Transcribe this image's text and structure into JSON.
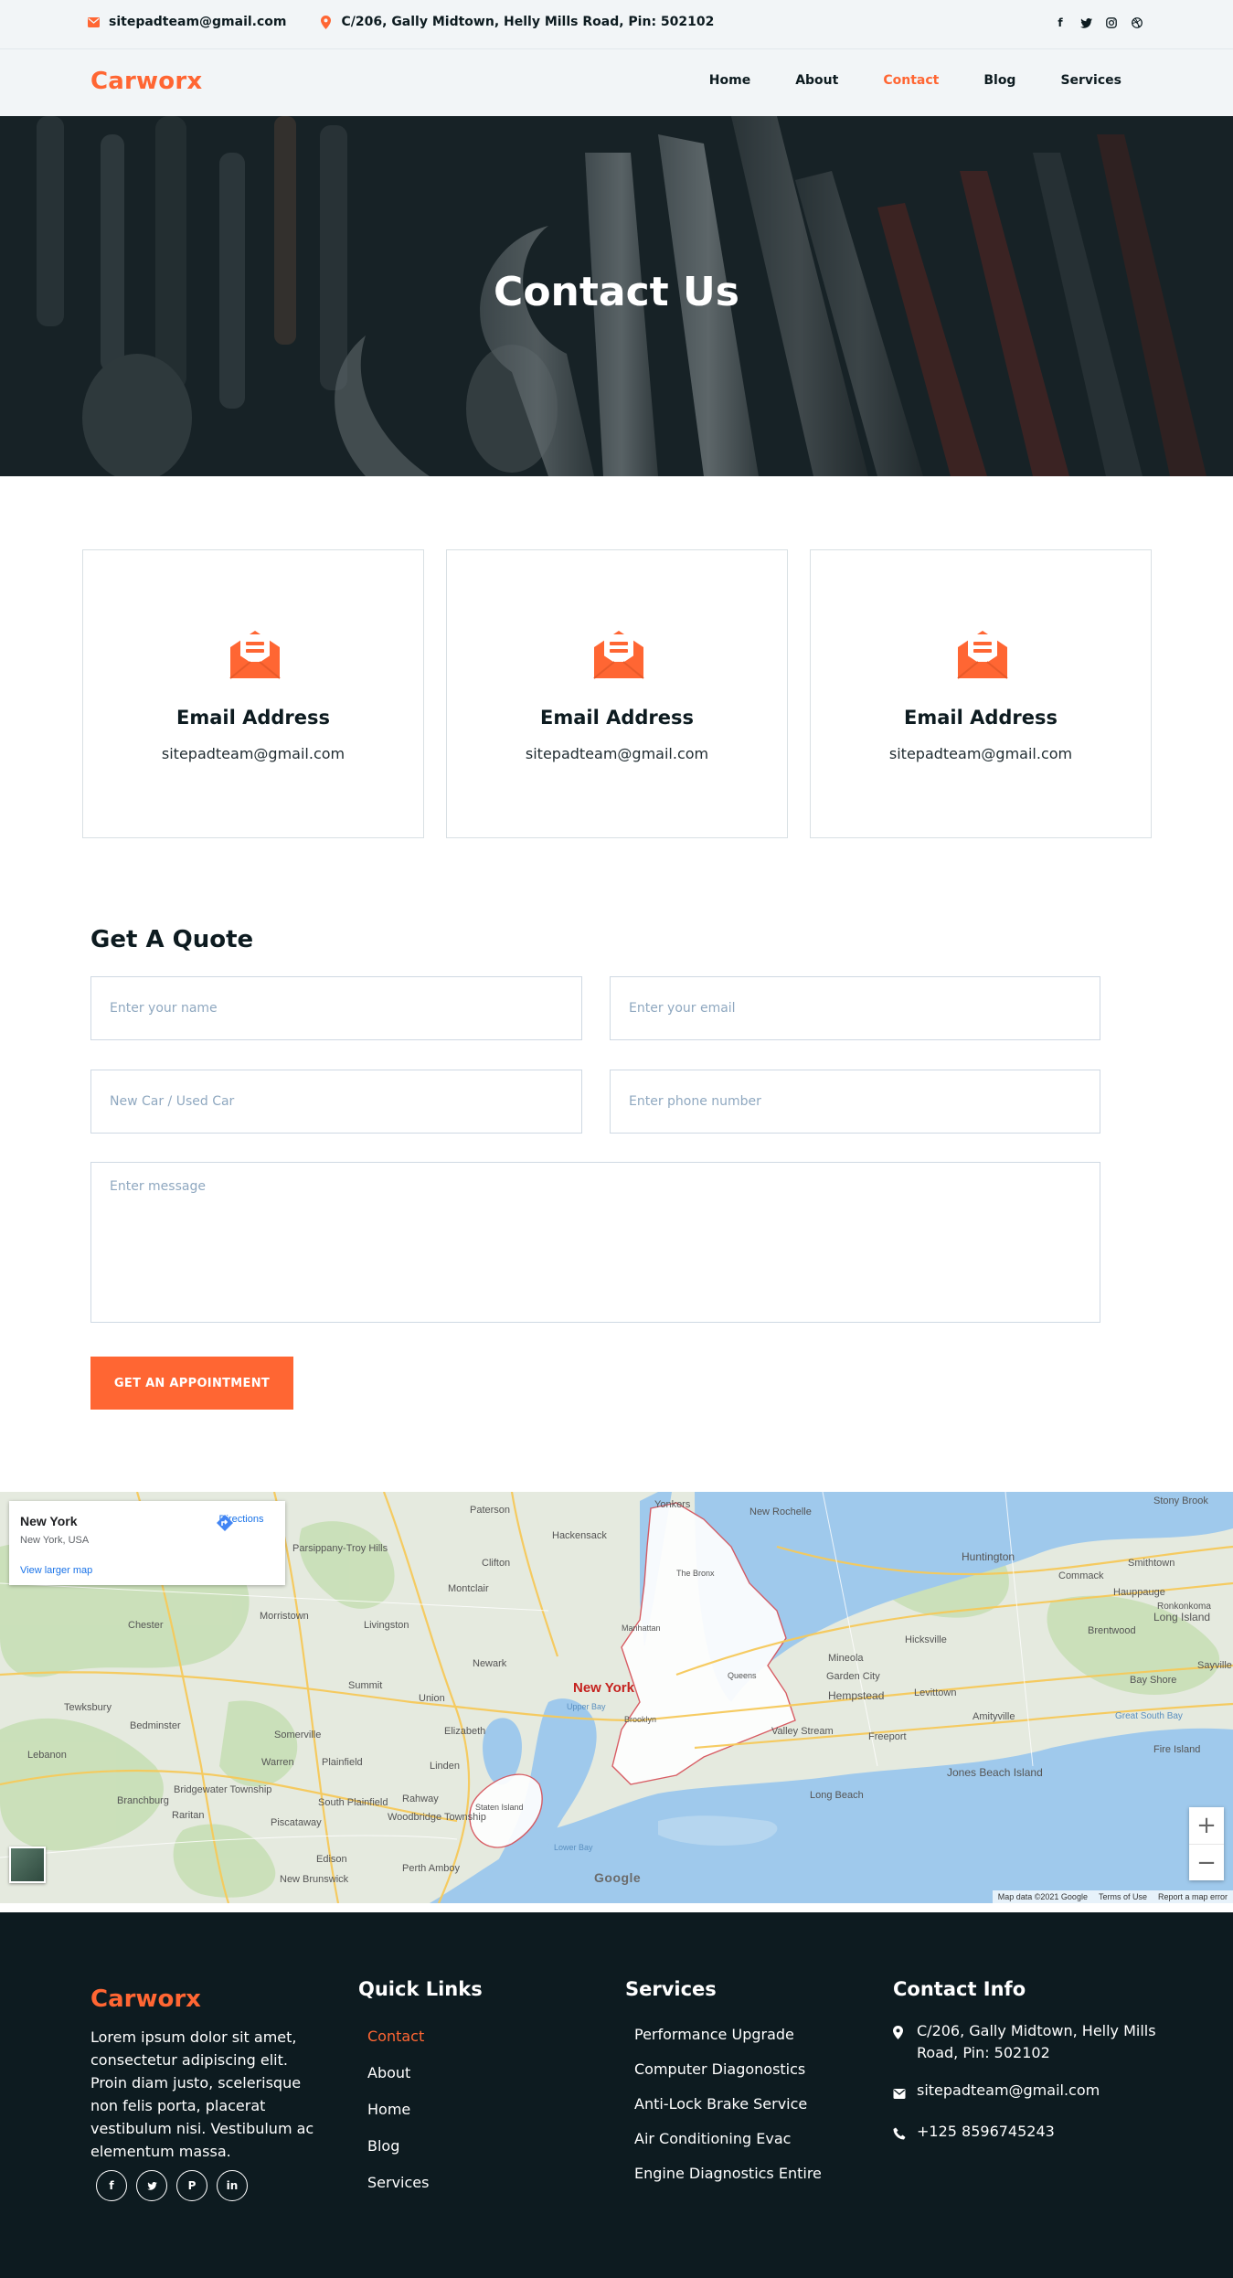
{
  "topbar": {
    "email": "sitepadteam@gmail.com",
    "address": "C/206, Gally Midtown, Helly Mills Road, Pin: 502102",
    "email_icon": "envelope-icon",
    "address_icon": "map-pin-icon",
    "social": [
      "facebook-icon",
      "twitter-icon",
      "instagram-icon",
      "dribbble-icon"
    ]
  },
  "nav": {
    "brand": "Carworx",
    "items": [
      {
        "label": "Home",
        "active": false
      },
      {
        "label": "About",
        "active": false
      },
      {
        "label": "Contact",
        "active": true
      },
      {
        "label": "Blog",
        "active": false
      },
      {
        "label": "Services",
        "active": false
      }
    ]
  },
  "hero": {
    "title": "Contact Us"
  },
  "cards": [
    {
      "title": "Email Address",
      "value": "sitepadteam@gmail.com",
      "icon": "open-envelope-icon"
    },
    {
      "title": "Email Address",
      "value": "sitepadteam@gmail.com",
      "icon": "open-envelope-icon"
    },
    {
      "title": "Email Address",
      "value": "sitepadteam@gmail.com",
      "icon": "open-envelope-icon"
    }
  ],
  "quote": {
    "title": "Get A Quote",
    "name_placeholder": "Enter your name",
    "email_placeholder": "Enter your email",
    "car_placeholder": "New Car / Used Car",
    "phone_placeholder": "Enter phone number",
    "message_placeholder": "Enter message",
    "submit_label": "GET AN APPOINTMENT"
  },
  "map": {
    "place_name": "New York",
    "place_address": "New York, USA",
    "directions_label": "Directions",
    "larger_map_label": "View larger map",
    "city_label": "New York",
    "zoom_in": "+",
    "zoom_out": "−",
    "google_label": "Google",
    "attribution": [
      "Map data ©2021 Google",
      "Terms of Use",
      "Report a map error"
    ],
    "labels": [
      "Yonkers",
      "New Rochelle",
      "Paterson",
      "Hackensack",
      "Clifton",
      "Montclair",
      "Newark",
      "Elizabeth",
      "Union",
      "Summit",
      "Morristown",
      "Livingston",
      "Edison",
      "Rahway",
      "Linden",
      "Plainfield",
      "Staten Island",
      "Brooklyn",
      "Queens",
      "Manhattan",
      "The Bronx",
      "Hempstead",
      "Long Beach",
      "Jones Beach Island",
      "Freeport",
      "Valley Stream",
      "Garden City",
      "Huntington",
      "Hicksville",
      "Levittown",
      "Amityville",
      "Great South Bay",
      "Fire Island",
      "Long Island",
      "Smithtown",
      "Brentwood",
      "Bay Shore",
      "Commack",
      "Hauppauge",
      "Ronkonkoma",
      "Sayville",
      "Stony Brook",
      "Mineola",
      "Bedminster",
      "Chester",
      "Tewksbury",
      "Somerville",
      "Bridgewater Township",
      "Branchburg",
      "Raritan",
      "Piscataway",
      "South Plainfield",
      "Woodbridge Township",
      "New Brunswick",
      "Perth Amboy",
      "Warren",
      "Lebanon",
      "Parsippany-Troy Hills",
      "Upper Bay",
      "Lower Bay"
    ]
  },
  "footer": {
    "brand": "Carworx",
    "description": "Lorem ipsum dolor sit amet, consectetur adipiscing elit. Proin diam justo, scelerisque non felis porta, placerat vestibulum nisi. Vestibulum ac elementum massa.",
    "social": [
      "facebook-icon",
      "twitter-icon",
      "pinterest-icon",
      "linkedin-icon"
    ],
    "quick_links_title": "Quick Links",
    "quick_links": [
      {
        "label": "Contact",
        "active": true
      },
      {
        "label": "About",
        "active": false
      },
      {
        "label": "Home",
        "active": false
      },
      {
        "label": "Blog",
        "active": false
      },
      {
        "label": "Services",
        "active": false
      }
    ],
    "services_title": "Services",
    "services": [
      "Performance Upgrade",
      "Computer Diagonostics",
      "Anti-Lock Brake Service",
      "Air Conditioning Evac",
      "Engine Diagnostics Entire"
    ],
    "contact_title": "Contact Info",
    "contact_address": "C/206, Gally Midtown, Helly Mills Road, Pin: 502102",
    "contact_email": "sitepadteam@gmail.com",
    "contact_phone": "+125 8596745243"
  },
  "colors": {
    "accent": "#ff6633",
    "dark": "#0d1b20",
    "light_bg": "#f2f5f7"
  }
}
